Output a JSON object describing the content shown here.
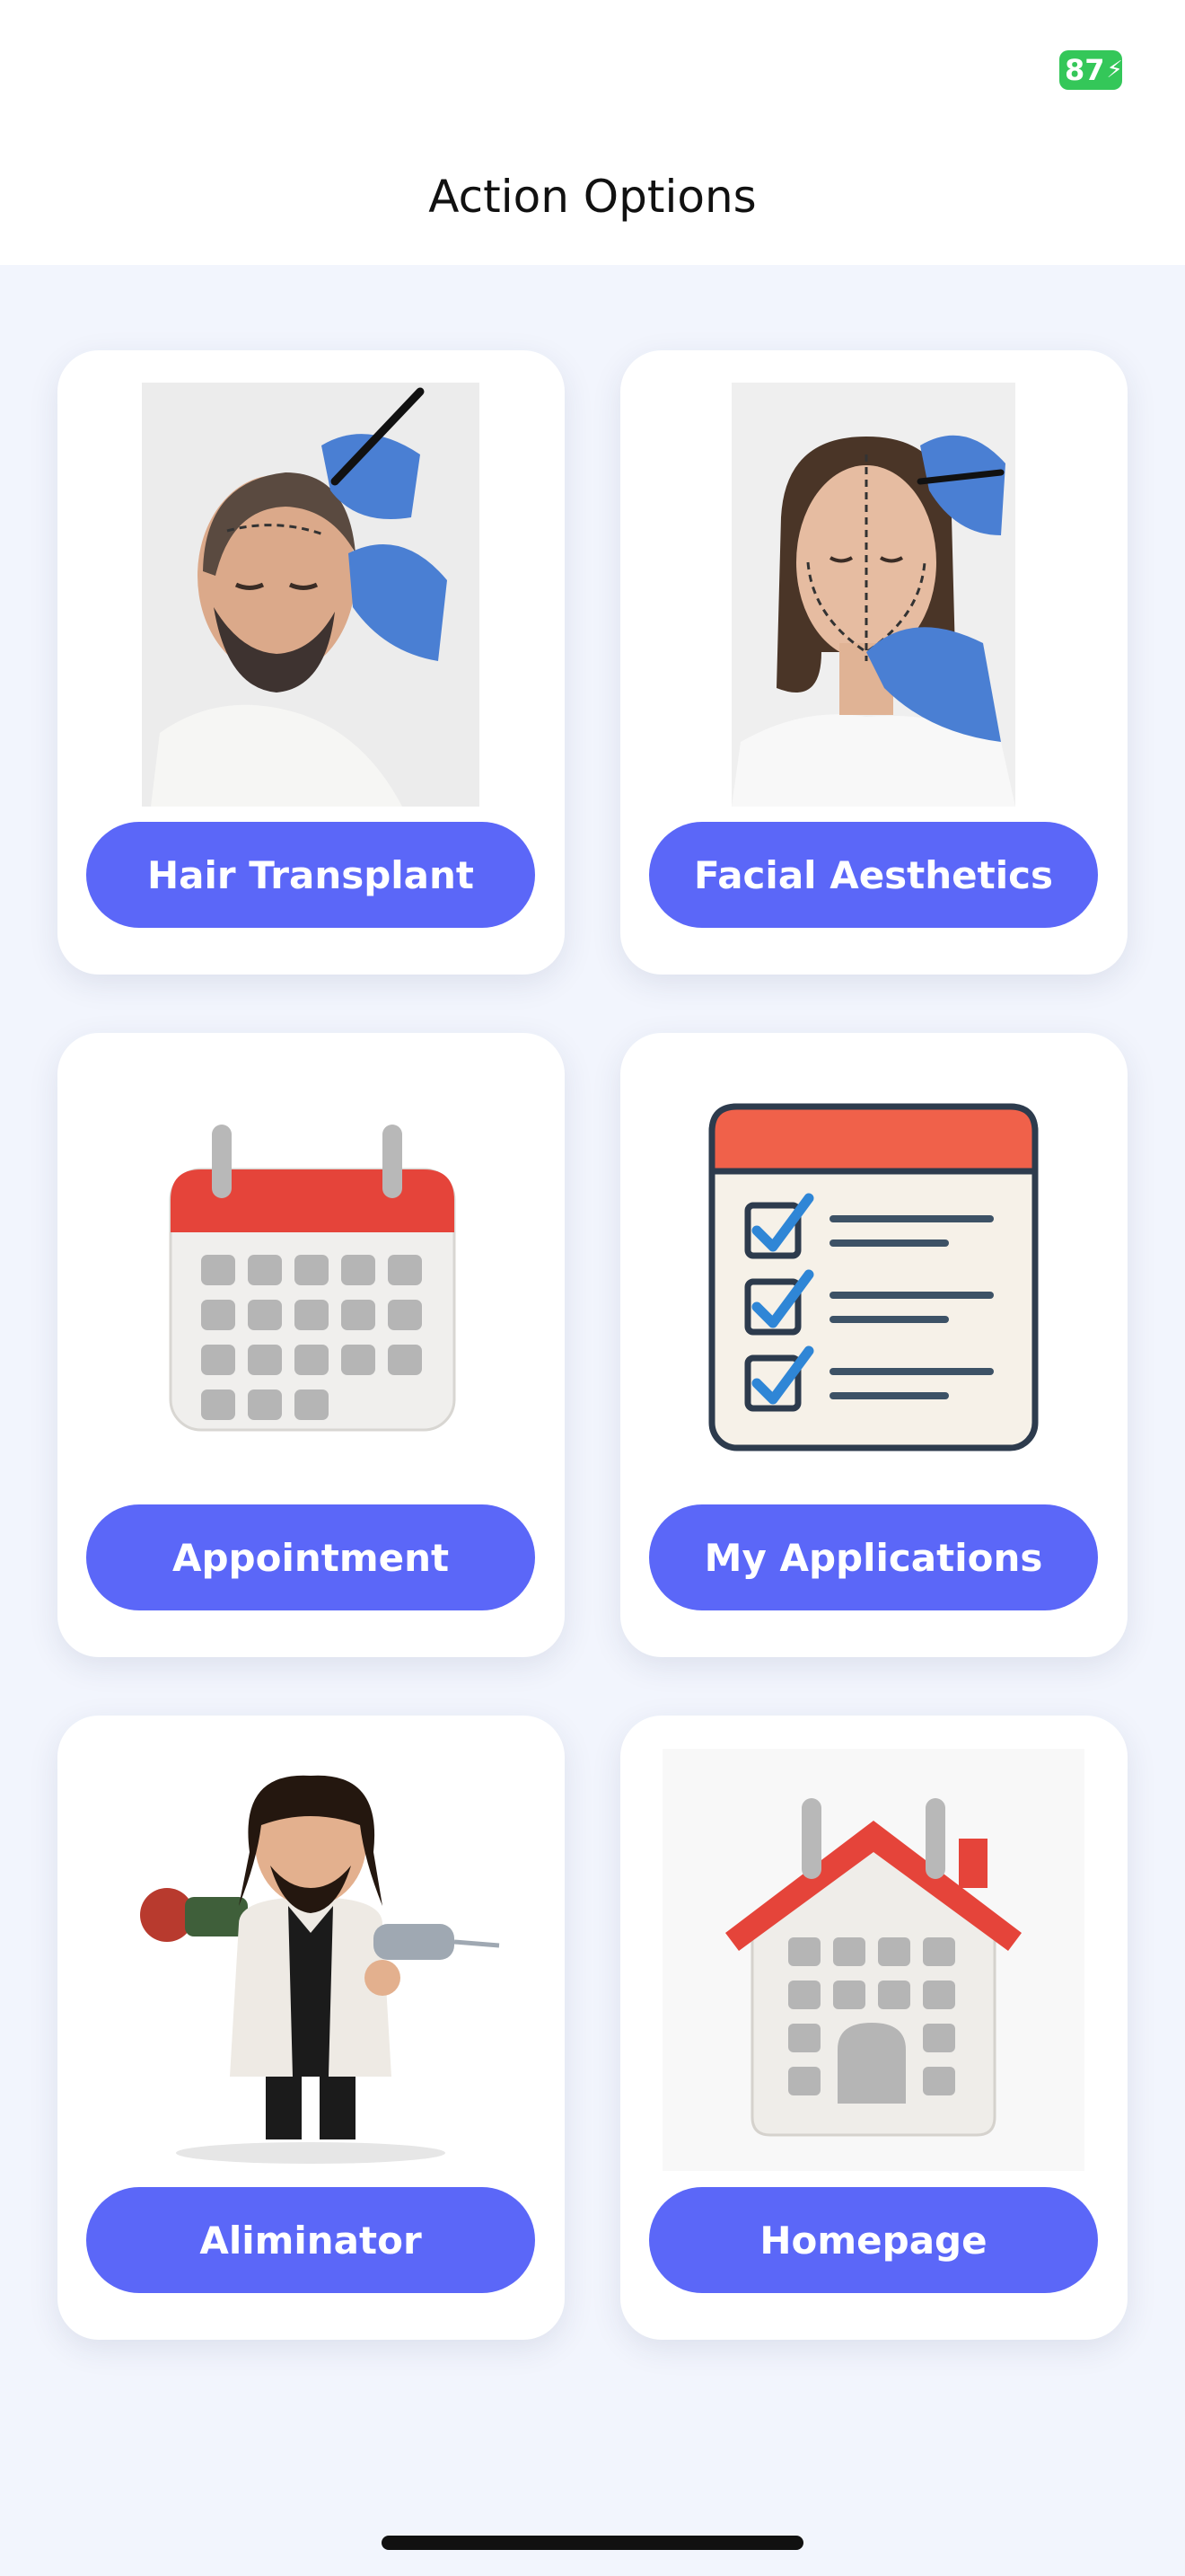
{
  "status_bar": {
    "battery": "87"
  },
  "header": {
    "title": "Action Options"
  },
  "cards": [
    {
      "label": "Hair Transplant",
      "image": "hair-transplant-photo"
    },
    {
      "label": "Facial Aesthetics",
      "image": "facial-aesthetics-photo"
    },
    {
      "label": "Appointment",
      "image": "calendar-icon"
    },
    {
      "label": "My Applications",
      "image": "checklist-calendar-icon"
    },
    {
      "label": "Aliminator",
      "image": "doctor-figurine-illustration"
    },
    {
      "label": "Homepage",
      "image": "home-calendar-icon"
    }
  ],
  "colors": {
    "accent": "#5b67f8",
    "background": "#f2f5fd",
    "battery": "#34c759"
  }
}
